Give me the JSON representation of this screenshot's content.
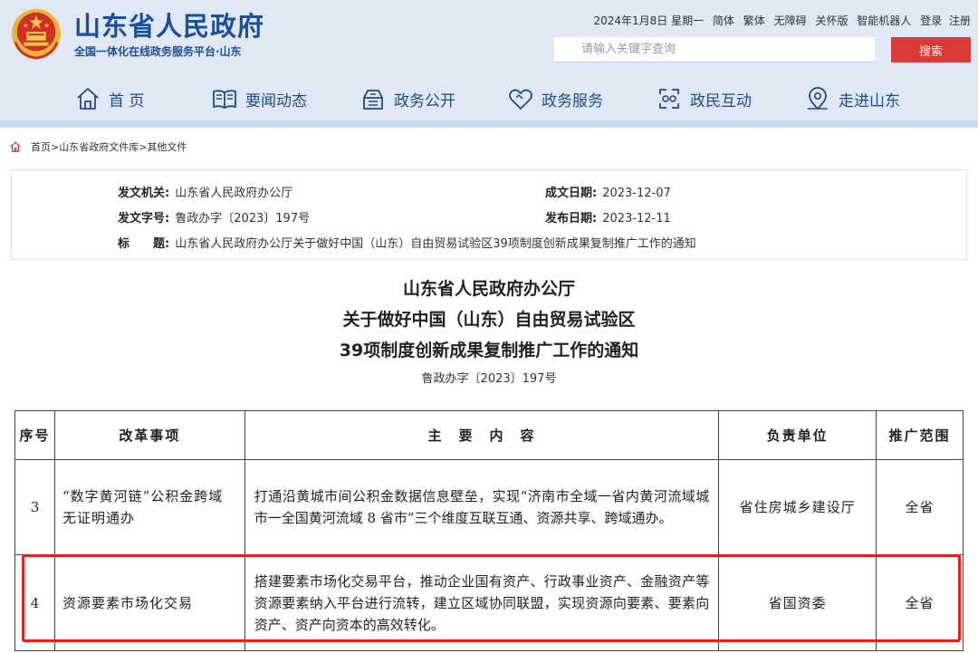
{
  "site": {
    "title": "山东省人民政府",
    "subtitle": "全国一体化在线政务服务平台·山东",
    "emblem_icon": "national-emblem-icon",
    "brand_color": "#1b4f9c",
    "accent_color": "#d93a36"
  },
  "toplinks": {
    "date": "2024年1月8日 星期一",
    "items": [
      "简体",
      "繁体",
      "无障碍",
      "关怀版",
      "智能机器人",
      "登录",
      "注册"
    ]
  },
  "search": {
    "placeholder": "请输入关键字查询",
    "button": "搜索"
  },
  "nav": [
    {
      "label": "首 页",
      "icon": "home-icon"
    },
    {
      "label": "要闻动态",
      "icon": "book-icon"
    },
    {
      "label": "政务公开",
      "icon": "inbox-icon"
    },
    {
      "label": "政务服务",
      "icon": "heart-icon"
    },
    {
      "label": "政民互动",
      "icon": "interaction-icon"
    },
    {
      "label": "走进山东",
      "icon": "location-icon"
    }
  ],
  "breadcrumb": {
    "icon": "home-icon",
    "items": [
      "首页",
      "山东省政府文件库",
      "其他文件"
    ],
    "separator": ">"
  },
  "info": {
    "issuer_label": "发文机关:",
    "issuer": "山东省人民政府办公厅",
    "written_label": "成文日期:",
    "written_date": "2023-12-07",
    "docno_label": "发文字号:",
    "docno": "鲁政办字〔2023〕197号",
    "published_label": "发布日期:",
    "published_date": "2023-12-11",
    "title_label": "标　　题:",
    "title": "山东省人民政府办公厅关于做好中国（山东）自由贸易试验区39项制度创新成果复制推广工作的通知"
  },
  "document": {
    "heading_line1": "山东省人民政府办公厅",
    "heading_line2": "关于做好中国（山东）自由贸易试验区",
    "heading_line3": "39项制度创新成果复制推广工作的通知",
    "number": "鲁政办字〔2023〕197号"
  },
  "table": {
    "headers": [
      "序号",
      "改革事项",
      "主　要　内　容",
      "负责单位",
      "推广范围"
    ],
    "rows": [
      {
        "no": "3",
        "item": "“数字黄河链”公积金跨域无证明通办",
        "content": "打通沿黄城市间公积金数据信息壁垒，实现“济南市全域一省内黄河流域城市一全国黄河流域 8 省市”三个维度互联互通、资源共享、跨域通办。",
        "unit": "省住房城乡建设厅",
        "scope": "全省"
      },
      {
        "no": "4",
        "item": "资源要素市场化交易",
        "content": "搭建要素市场化交易平台，推动企业国有资产、行政事业资产、金融资产等资源要素纳入平台进行流转，建立区域协同联盟，实现资源向要素、要素向资产、资产向资本的高效转化。",
        "unit": "省国资委",
        "scope": "全省"
      }
    ],
    "highlight_color": "#e0201c"
  }
}
